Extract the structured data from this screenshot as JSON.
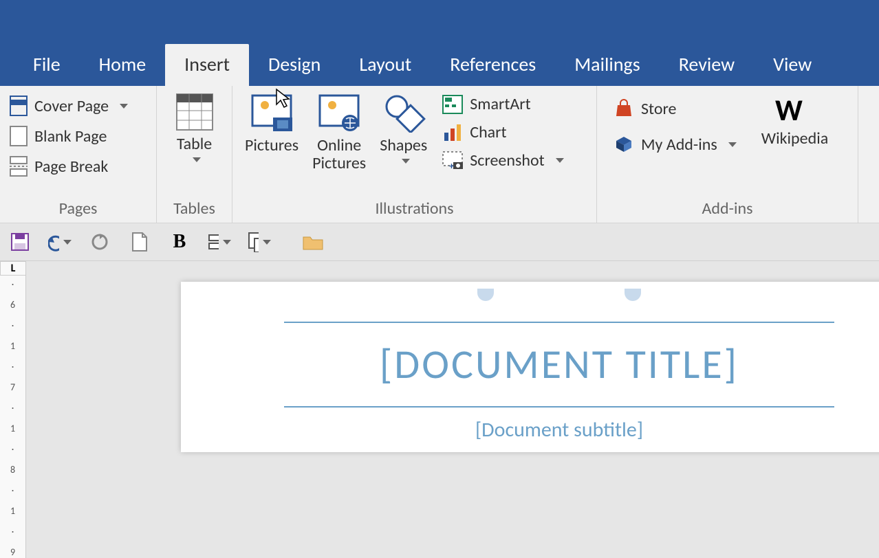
{
  "tabs": {
    "file": "File",
    "home": "Home",
    "insert": "Insert",
    "design": "Design",
    "layout": "Layout",
    "references": "References",
    "mailings": "Mailings",
    "review": "Review",
    "view": "View"
  },
  "active_tab": "insert",
  "ribbon": {
    "pages": {
      "label": "Pages",
      "cover_page": "Cover Page",
      "blank_page": "Blank Page",
      "page_break": "Page Break"
    },
    "tables": {
      "label": "Tables",
      "table": "Table"
    },
    "illustrations": {
      "label": "Illustrations",
      "pictures": "Pictures",
      "online_pictures_l1": "Online",
      "online_pictures_l2": "Pictures",
      "shapes": "Shapes",
      "smartart": "SmartArt",
      "chart": "Chart",
      "screenshot": "Screenshot"
    },
    "addins": {
      "label": "Add-ins",
      "store": "Store",
      "my_addins": "My Add-ins",
      "wikipedia": "Wikipedia"
    }
  },
  "ruler_corner": "L",
  "ruler_marks": [
    "·",
    "6",
    "·",
    "1",
    "·",
    "7",
    "·",
    "1",
    "·",
    "8",
    "·",
    "1",
    "·",
    "9"
  ],
  "document": {
    "title": "[DOCUMENT TITLE]",
    "subtitle": "[Document subtitle]"
  },
  "colors": {
    "primary": "#2b579a",
    "accent": "#6aa0c8"
  }
}
